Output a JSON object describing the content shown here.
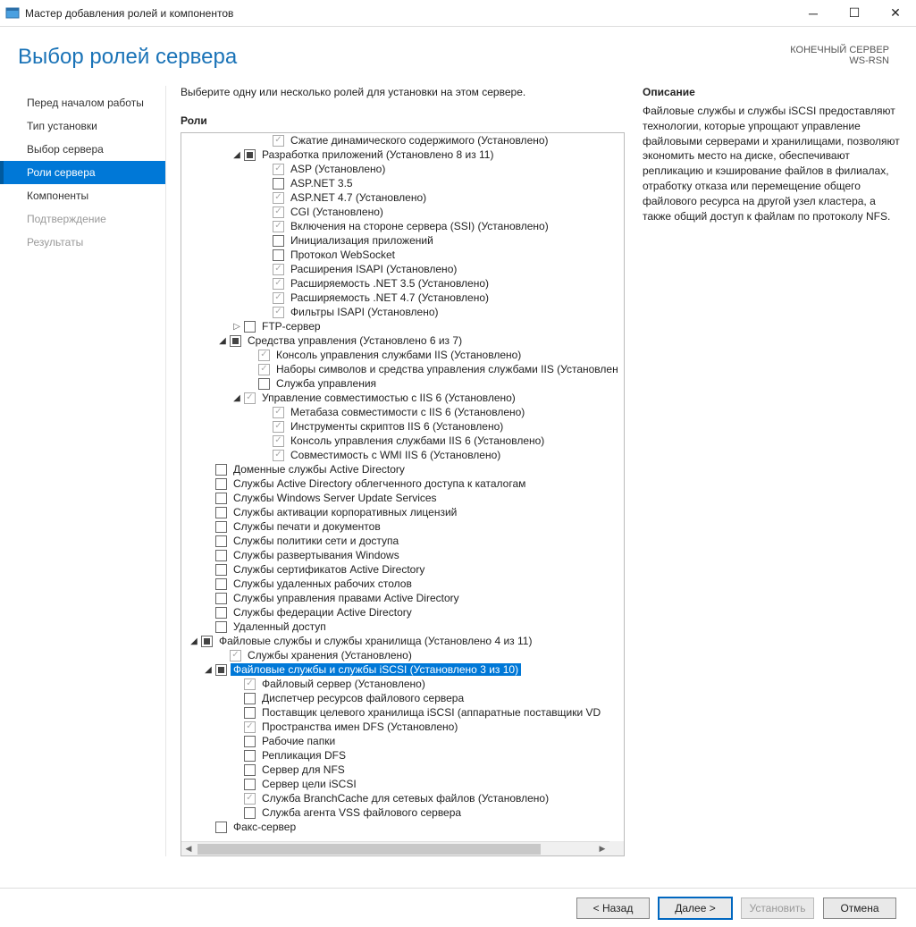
{
  "window": {
    "title": "Мастер добавления ролей и компонентов"
  },
  "header": {
    "title": "Выбор ролей сервера",
    "target_label": "КОНЕЧНЫЙ СЕРВЕР",
    "target_name": "WS-RSN"
  },
  "nav": {
    "items": [
      {
        "label": "Перед началом работы",
        "state": "normal"
      },
      {
        "label": "Тип установки",
        "state": "normal"
      },
      {
        "label": "Выбор сервера",
        "state": "normal"
      },
      {
        "label": "Роли сервера",
        "state": "active"
      },
      {
        "label": "Компоненты",
        "state": "normal"
      },
      {
        "label": "Подтверждение",
        "state": "disabled"
      },
      {
        "label": "Результаты",
        "state": "disabled"
      }
    ]
  },
  "content": {
    "instruction": "Выберите одну или несколько ролей для установки на этом сервере.",
    "roles_label": "Роли",
    "description_label": "Описание",
    "description_text": "Файловые службы и службы iSCSI предоставляют технологии, которые упрощают управление файловыми серверами и хранилищами, позволяют экономить место на диске, обеспечивают репликацию и кэширование файлов в филиалах, отработку отказа или перемещение общего файлового ресурса на другой узел кластера, а также общий доступ к файлам по протоколу NFS."
  },
  "tree": [
    {
      "indent": 5,
      "expander": "none",
      "check": "checked-dim",
      "label": "Сжатие динамического содержимого (Установлено)"
    },
    {
      "indent": 3,
      "expander": "open",
      "check": "partial",
      "label": "Разработка приложений (Установлено 8 из 11)"
    },
    {
      "indent": 5,
      "expander": "none",
      "check": "checked-dim",
      "label": "ASP (Установлено)"
    },
    {
      "indent": 5,
      "expander": "none",
      "check": "empty",
      "label": "ASP.NET 3.5"
    },
    {
      "indent": 5,
      "expander": "none",
      "check": "checked-dim",
      "label": "ASP.NET 4.7 (Установлено)"
    },
    {
      "indent": 5,
      "expander": "none",
      "check": "checked-dim",
      "label": "CGI (Установлено)"
    },
    {
      "indent": 5,
      "expander": "none",
      "check": "checked-dim",
      "label": "Включения на стороне сервера (SSI) (Установлено)"
    },
    {
      "indent": 5,
      "expander": "none",
      "check": "empty",
      "label": "Инициализация приложений"
    },
    {
      "indent": 5,
      "expander": "none",
      "check": "empty",
      "label": "Протокол WebSocket"
    },
    {
      "indent": 5,
      "expander": "none",
      "check": "checked-dim",
      "label": "Расширения ISAPI (Установлено)"
    },
    {
      "indent": 5,
      "expander": "none",
      "check": "checked-dim",
      "label": "Расширяемость .NET 3.5 (Установлено)"
    },
    {
      "indent": 5,
      "expander": "none",
      "check": "checked-dim",
      "label": "Расширяемость .NET 4.7 (Установлено)"
    },
    {
      "indent": 5,
      "expander": "none",
      "check": "checked-dim",
      "label": "Фильтры ISAPI (Установлено)"
    },
    {
      "indent": 3,
      "expander": "closed",
      "check": "empty",
      "label": "FTP-сервер"
    },
    {
      "indent": 2,
      "expander": "open",
      "check": "partial",
      "label": "Средства управления (Установлено 6 из 7)"
    },
    {
      "indent": 4,
      "expander": "none",
      "check": "checked-dim",
      "label": "Консоль управления службами IIS (Установлено)"
    },
    {
      "indent": 4,
      "expander": "none",
      "check": "checked-dim",
      "label": "Наборы символов и средства управления службами IIS (Установлен"
    },
    {
      "indent": 4,
      "expander": "none",
      "check": "empty",
      "label": "Служба управления"
    },
    {
      "indent": 3,
      "expander": "open",
      "check": "checked-dim",
      "label": "Управление совместимостью с IIS 6 (Установлено)"
    },
    {
      "indent": 5,
      "expander": "none",
      "check": "checked-dim",
      "label": "Метабаза совместимости с IIS 6 (Установлено)"
    },
    {
      "indent": 5,
      "expander": "none",
      "check": "checked-dim",
      "label": "Инструменты скриптов IIS 6 (Установлено)"
    },
    {
      "indent": 5,
      "expander": "none",
      "check": "checked-dim",
      "label": "Консоль управления службами IIS 6 (Установлено)"
    },
    {
      "indent": 5,
      "expander": "none",
      "check": "checked-dim",
      "label": "Совместимость с WMI IIS 6 (Установлено)"
    },
    {
      "indent": 1,
      "expander": "none",
      "check": "empty",
      "label": "Доменные службы Active Directory"
    },
    {
      "indent": 1,
      "expander": "none",
      "check": "empty",
      "label": "Службы Active Directory облегченного доступа к каталогам"
    },
    {
      "indent": 1,
      "expander": "none",
      "check": "empty",
      "label": "Службы Windows Server Update Services"
    },
    {
      "indent": 1,
      "expander": "none",
      "check": "empty",
      "label": "Службы активации корпоративных лицензий"
    },
    {
      "indent": 1,
      "expander": "none",
      "check": "empty",
      "label": "Службы печати и документов"
    },
    {
      "indent": 1,
      "expander": "none",
      "check": "empty",
      "label": "Службы политики сети и доступа"
    },
    {
      "indent": 1,
      "expander": "none",
      "check": "empty",
      "label": "Службы развертывания Windows"
    },
    {
      "indent": 1,
      "expander": "none",
      "check": "empty",
      "label": "Службы сертификатов Active Directory"
    },
    {
      "indent": 1,
      "expander": "none",
      "check": "empty",
      "label": "Службы удаленных рабочих столов"
    },
    {
      "indent": 1,
      "expander": "none",
      "check": "empty",
      "label": "Службы управления правами Active Directory"
    },
    {
      "indent": 1,
      "expander": "none",
      "check": "empty",
      "label": "Службы федерации Active Directory"
    },
    {
      "indent": 1,
      "expander": "none",
      "check": "empty",
      "label": "Удаленный доступ"
    },
    {
      "indent": 0,
      "expander": "open",
      "check": "partial",
      "label": "Файловые службы и службы хранилища (Установлено 4 из 11)"
    },
    {
      "indent": 2,
      "expander": "none",
      "check": "checked-dim",
      "label": "Службы хранения (Установлено)"
    },
    {
      "indent": 1,
      "expander": "open",
      "check": "partial",
      "label": "Файловые службы и службы iSCSI (Установлено 3 из 10)",
      "selected": true
    },
    {
      "indent": 3,
      "expander": "none",
      "check": "checked-dim",
      "label": "Файловый сервер (Установлено)"
    },
    {
      "indent": 3,
      "expander": "none",
      "check": "empty",
      "label": "Диспетчер ресурсов файлового сервера"
    },
    {
      "indent": 3,
      "expander": "none",
      "check": "empty",
      "label": "Поставщик целевого хранилища iSCSI (аппаратные поставщики VD"
    },
    {
      "indent": 3,
      "expander": "none",
      "check": "checked-dim",
      "label": "Пространства имен DFS (Установлено)"
    },
    {
      "indent": 3,
      "expander": "none",
      "check": "empty",
      "label": "Рабочие папки"
    },
    {
      "indent": 3,
      "expander": "none",
      "check": "empty",
      "label": "Репликация DFS"
    },
    {
      "indent": 3,
      "expander": "none",
      "check": "empty",
      "label": "Сервер для NFS"
    },
    {
      "indent": 3,
      "expander": "none",
      "check": "empty",
      "label": "Сервер цели iSCSI"
    },
    {
      "indent": 3,
      "expander": "none",
      "check": "checked-dim",
      "label": "Служба BranchCache для сетевых файлов (Установлено)"
    },
    {
      "indent": 3,
      "expander": "none",
      "check": "empty",
      "label": "Служба агента VSS файлового сервера"
    },
    {
      "indent": 1,
      "expander": "none",
      "check": "empty",
      "label": "Факс-сервер"
    }
  ],
  "footer": {
    "back": "< Назад",
    "next": "Далее >",
    "install": "Установить",
    "cancel": "Отмена"
  }
}
